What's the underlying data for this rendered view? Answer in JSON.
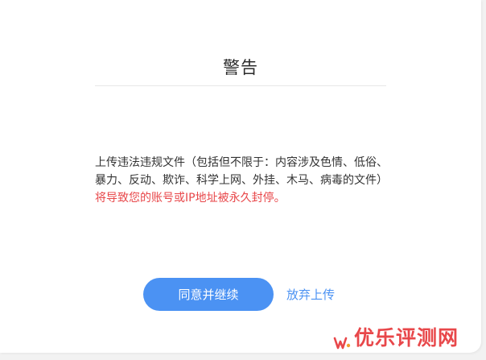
{
  "dialog": {
    "title": "警告",
    "message_plain": "上传违法违规文件（包括但不限于：内容涉及色情、低俗、暴力、反动、欺诈、科学上网、外挂、木马、病毒的文件）",
    "message_warning": "将导致您的账号或IP地址被永久封停。",
    "continue_label": "同意并继续",
    "abandon_label": "放弃上传"
  },
  "watermark": {
    "text": "优乐评测网"
  },
  "colors": {
    "accent": "#4b92f3",
    "warning": "#e8474a",
    "text": "#333333",
    "background": "#ffffff"
  }
}
